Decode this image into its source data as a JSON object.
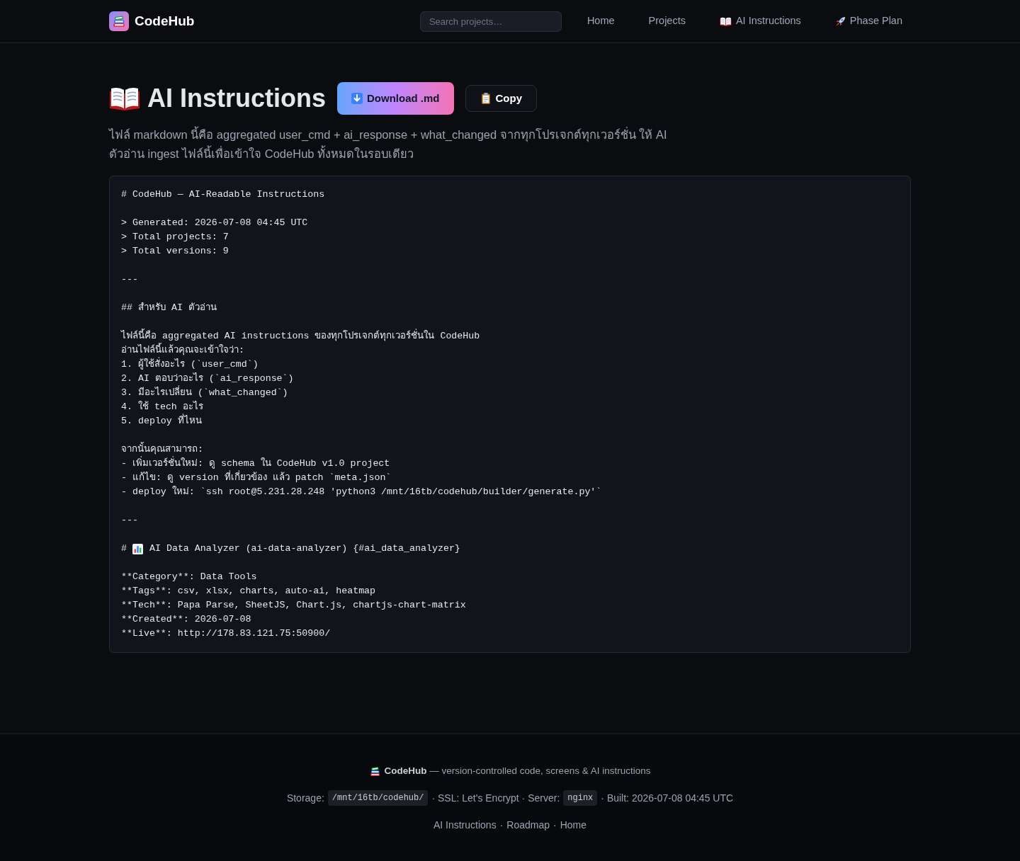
{
  "header": {
    "logo": "CodeHub",
    "search": {
      "placeholder": "Search projects…"
    },
    "nav": [
      {
        "kind": "plain",
        "label": "Home"
      },
      {
        "kind": "plain",
        "label": "Projects"
      },
      {
        "kind": "book",
        "label": "AI Instructions"
      },
      {
        "kind": "rocket",
        "label": "Phase Plan"
      }
    ]
  },
  "title": "AI Instructions",
  "actions": [
    {
      "kind": "download",
      "label": "Download .md"
    },
    {
      "kind": "copy",
      "label": "Copy"
    }
  ],
  "description": "ไฟล์ markdown นี้คือ aggregated user_cmd + ai_response + what_changed จากทุกโปรเจกต์ทุกเวอร์ชั่น ให้ AI ตัวอ่าน ingest ไฟล์นี้เพื่อเข้าใจ CodeHub ทั้งหมดในรอบเดียว",
  "markdown_blocks": [
    [
      {
        "kind": "plain",
        "text": "# CodeHub — AI-Readable Instructions"
      }
    ],
    [
      {
        "kind": "plain",
        "text": "> Generated: 2026-07-08 04:45 UTC"
      },
      {
        "kind": "plain",
        "text": "> Total projects: 7"
      },
      {
        "kind": "plain",
        "text": "> Total versions: 9"
      }
    ],
    [
      {
        "kind": "plain",
        "text": "---"
      }
    ],
    [
      {
        "kind": "plain",
        "text": "## สำหรับ AI ตัวอ่าน"
      }
    ],
    [
      {
        "kind": "plain",
        "text": "ไฟล์นี้คือ aggregated AI instructions ของทุกโปรเจกต์ทุกเวอร์ชั่นใน CodeHub"
      },
      {
        "kind": "plain",
        "text": "อ่านไฟล์นี้แล้วคุณจะเข้าใจว่า:"
      },
      {
        "kind": "plain",
        "text": "1. ผู้ใช้สั่งอะไร (`user_cmd`)"
      },
      {
        "kind": "plain",
        "text": "2. AI ตอบว่าอะไร (`ai_response`)"
      },
      {
        "kind": "plain",
        "text": "3. มีอะไรเปลี่ยน (`what_changed`)"
      },
      {
        "kind": "plain",
        "text": "4. ใช้ tech อะไร"
      },
      {
        "kind": "plain",
        "text": "5. deploy ที่ไหน"
      }
    ],
    [
      {
        "kind": "plain",
        "text": "จากนั้นคุณสามารถ:"
      },
      {
        "kind": "plain",
        "text": "- เพิ่มเวอร์ชั่นใหม่: ดู schema ใน CodeHub v1.0 project"
      },
      {
        "kind": "plain",
        "text": "- แก้ไข: ดู version ที่เกี่ยวข้อง แล้ว patch `meta.json`"
      },
      {
        "kind": "plain",
        "text": "- deploy ใหม่: `ssh root@5.231.28.248 'python3 /mnt/16tb/codehub/builder/generate.py'`"
      }
    ],
    [
      {
        "kind": "plain",
        "text": "---"
      }
    ],
    [
      {
        "kind": "icon_heading",
        "marker": "#",
        "text": "AI Data Analyzer (ai-data-analyzer) {#ai_data_analyzer}"
      }
    ],
    [
      {
        "kind": "plain",
        "text": "**Category**: Data Tools"
      },
      {
        "kind": "plain",
        "text": "**Tags**: csv, xlsx, charts, auto-ai, heatmap"
      },
      {
        "kind": "plain",
        "text": "**Tech**: Papa Parse, SheetJS, Chart.js, chartjs-chart-matrix"
      },
      {
        "kind": "plain",
        "text": "**Created**: 2026-07-08"
      },
      {
        "kind": "plain",
        "text": "**Live**: http://178.83.121.75:50900/"
      }
    ]
  ],
  "footer": {
    "tagline": "**CodeHub** — version-controlled code, screens & AI instructions",
    "meta": [
      {
        "kind": "text",
        "text": "Storage:"
      },
      {
        "kind": "code",
        "text": "/mnt/16tb/codehub/"
      },
      {
        "kind": "text",
        "text": "· SSL: Let's Encrypt · Server:"
      },
      {
        "kind": "code",
        "text": "nginx"
      },
      {
        "kind": "text",
        "text": "· Built: 2026-07-08 04:45 UTC"
      }
    ],
    "links": [
      "AI Instructions",
      "Roadmap",
      "Home"
    ],
    "separator": "·"
  }
}
